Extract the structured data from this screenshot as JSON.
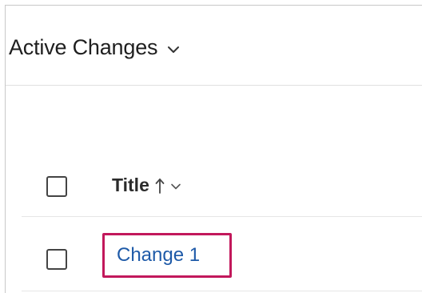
{
  "view": {
    "title": "Active Changes",
    "chevron_icon": "chevron-down-icon"
  },
  "list": {
    "columns": [
      {
        "label": "Title",
        "sort_icon": "sort-ascending-arrow-icon",
        "menu_icon": "chevron-down-icon"
      }
    ],
    "rows": [
      {
        "title": "Change 1",
        "highlighted": true
      }
    ]
  },
  "colors": {
    "link": "#1e5aa8",
    "highlight_border": "#c2185b",
    "text": "#1f1f1f",
    "divider": "#e0e0e0"
  }
}
